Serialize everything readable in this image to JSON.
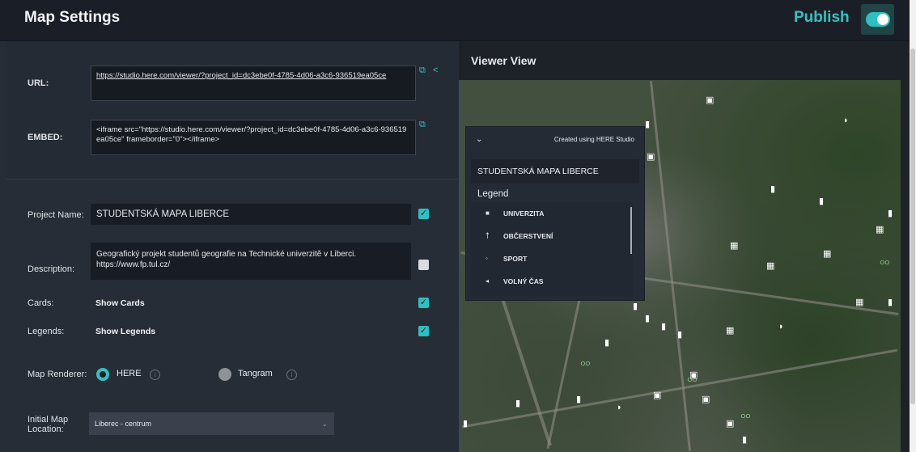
{
  "header": {
    "title": "Map Settings",
    "publish_label": "Publish",
    "publish_toggle_on": true
  },
  "share": {
    "url_label": "URL:",
    "url_value": "https://studio.here.com/viewer/?project_id=dc3ebe0f-4785-4d06-a3c6-936519ea05ce",
    "embed_label": "EMBED:",
    "embed_value": "<iframe src=\"https://studio.here.com/viewer/?project_id=dc3ebe0f-4785-4d06-a3c6-936519ea05ce\" frameborder=\"0\"></iframe>"
  },
  "settings": {
    "project_name_label": "Project Name:",
    "project_name_value": "STUDENTSKÁ MAPA LIBERCE",
    "project_name_checked": true,
    "description_label": "Description:",
    "description_value": "Geografický projekt studentů geografie na Technické univerzitě v Liberci. https://www.fp.tul.cz/",
    "description_checked": false,
    "cards_label": "Cards:",
    "cards_value": "Show Cards",
    "cards_checked": true,
    "legends_label": "Legends:",
    "legends_value": "Show Legends",
    "legends_checked": true,
    "renderer_label": "Map Renderer:",
    "renderer_options": [
      "HERE",
      "Tangram"
    ],
    "renderer_selected": "HERE",
    "initial_location_label": "Initial Map Location:",
    "initial_location_value": "Liberec - centrum"
  },
  "viewer": {
    "title": "Viewer View",
    "created_with": "Created using HERE Studio",
    "project_name": "STUDENTSKÁ MAPA LIBERCE",
    "legend_title": "Legend",
    "legend_items": [
      "UNIVERZITA",
      "OBČERSTVENÍ",
      "SPORT",
      "VOLNÝ ČAS"
    ]
  }
}
